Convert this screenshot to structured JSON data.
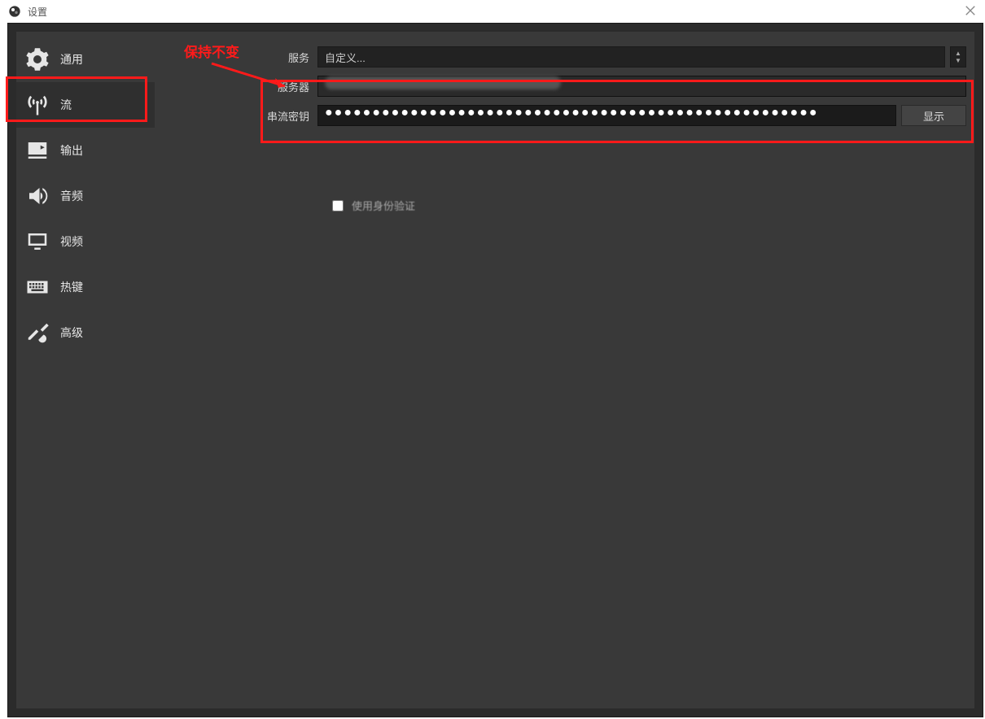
{
  "window": {
    "title": "设置"
  },
  "sidebar": {
    "items": [
      {
        "label": "通用"
      },
      {
        "label": "流"
      },
      {
        "label": "输出"
      },
      {
        "label": "音频"
      },
      {
        "label": "视频"
      },
      {
        "label": "热键"
      },
      {
        "label": "高级"
      }
    ],
    "active_index": 1
  },
  "form": {
    "service": {
      "label": "服务",
      "value": "自定义..."
    },
    "server": {
      "label": "服务器",
      "value": ""
    },
    "stream_key": {
      "label": "串流密钥",
      "value": "●●●●●●●●●●●●●●●●●●●●●●●●●●●●●●●●●●●●●●●●●●●●●●●●●●●●",
      "show_button": "显示"
    },
    "use_auth": {
      "label": "使用身份验证",
      "checked": false
    }
  },
  "annotations": {
    "keep_unchanged": "保持不变"
  },
  "colors": {
    "annotation_red": "#ff1a1a",
    "bg_dark": "#393939",
    "bg_darker": "#2b2b2b",
    "input_bg": "#1b1b1b"
  }
}
